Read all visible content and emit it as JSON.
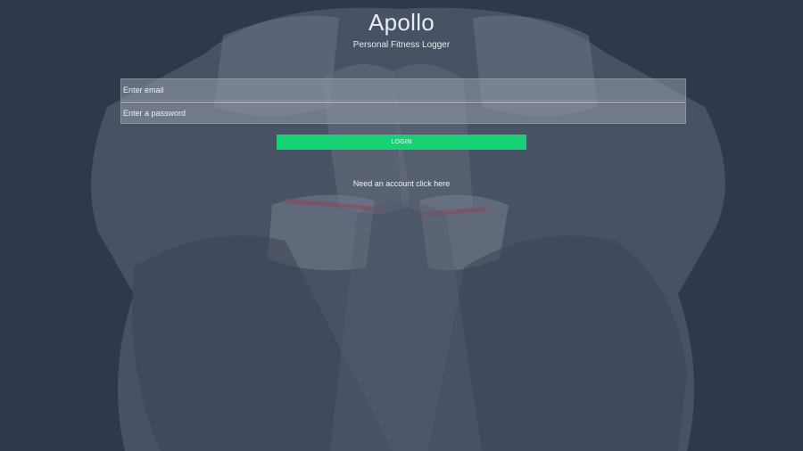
{
  "app": {
    "title": "Apollo",
    "subtitle": "Personal Fitness Logger"
  },
  "form": {
    "email_placeholder": "Enter email",
    "email_value": "",
    "password_placeholder": "Enter a password",
    "password_value": "",
    "login_label": "LOGIN",
    "signup_link_label": "Need an account click here"
  },
  "colors": {
    "overlay": "#2f3a4e",
    "accent": "#16d275",
    "text": "#eef0f4"
  }
}
